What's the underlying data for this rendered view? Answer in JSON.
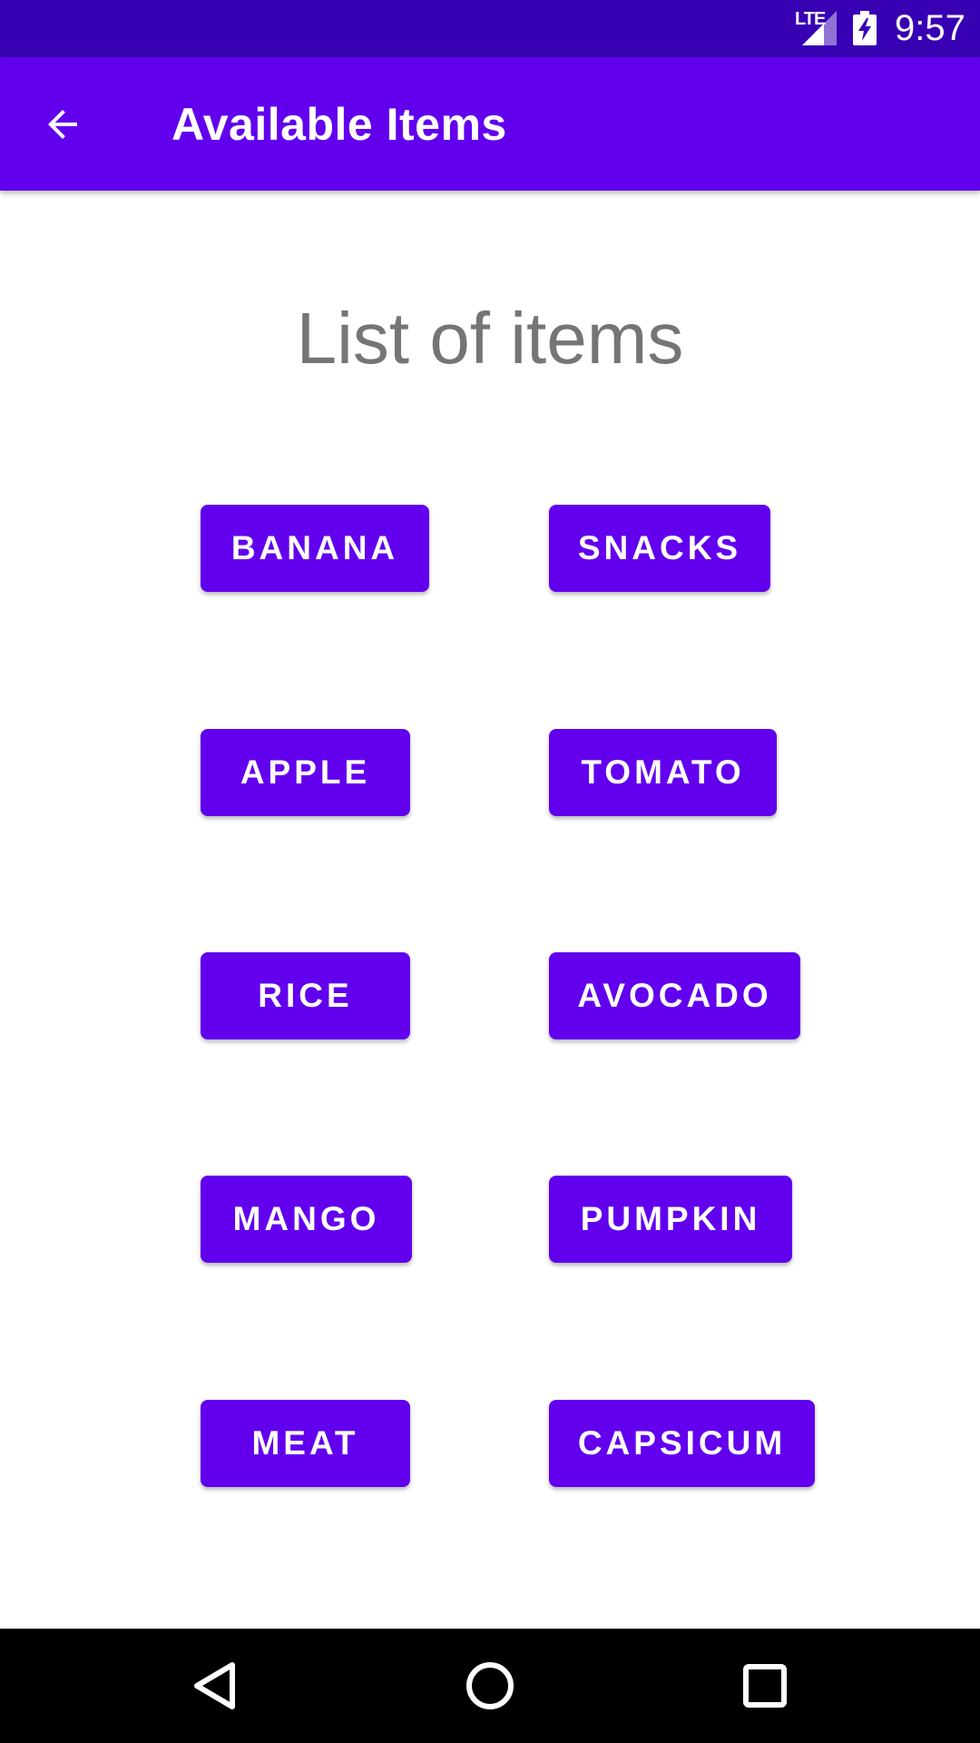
{
  "status_bar": {
    "network": "LTE",
    "time": "9:57",
    "icons": [
      "lte-signal-icon",
      "battery-charging-icon"
    ]
  },
  "app_bar": {
    "title": "Available Items",
    "back_icon": "arrow-back-icon"
  },
  "main": {
    "heading": "List of items",
    "items": [
      {
        "label": "BANANA"
      },
      {
        "label": "SNACKS"
      },
      {
        "label": "APPLE"
      },
      {
        "label": "TOMATO"
      },
      {
        "label": "RICE"
      },
      {
        "label": "AVOCADO"
      },
      {
        "label": "MANGO"
      },
      {
        "label": "PUMPKIN"
      },
      {
        "label": "MEAT"
      },
      {
        "label": "CAPSICUM"
      }
    ]
  },
  "nav_bar": {
    "icons": [
      "back-triangle-icon",
      "home-circle-icon",
      "recents-square-icon"
    ]
  },
  "colors": {
    "status_bar": "#3700b3",
    "primary": "#6200ee",
    "heading_text": "#757575",
    "nav_bar": "#000000"
  }
}
